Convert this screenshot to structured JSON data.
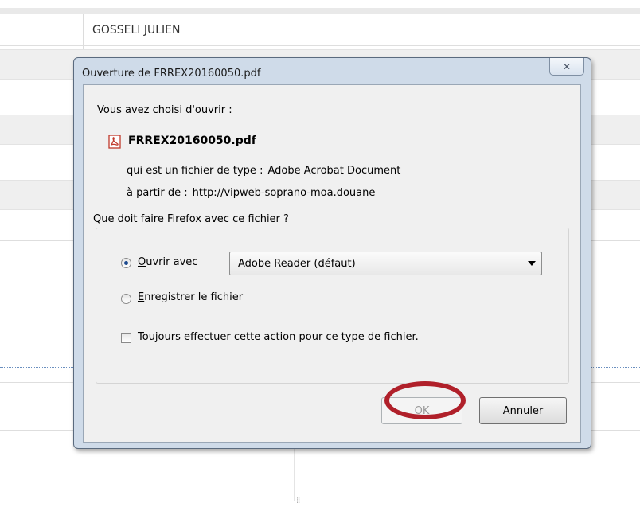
{
  "background": {
    "name_cell": "GOSSELI JULIEN"
  },
  "dialog": {
    "title": "Ouverture de FRREX20160050.pdf",
    "close_label": "✕",
    "intro": "Vous avez choisi d'ouvrir :",
    "file_icon": "pdf-icon",
    "filename": "FRREX20160050.pdf",
    "type_label": "qui est un fichier de type :",
    "type_value": "Adobe Acrobat Document",
    "from_label": "à partir de :",
    "from_value": "http://vipweb-soprano-moa.douane",
    "group_title": "Que doit faire Firefox avec ce fichier ?",
    "open_with_first": "O",
    "open_with_rest": "uvrir avec",
    "open_with_checked": true,
    "app_selected": "Adobe Reader  (défaut)",
    "save_first": "E",
    "save_rest": "nregistrer le fichier",
    "save_checked": false,
    "always_first": "T",
    "always_rest": "oujours effectuer cette action pour ce type de fichier.",
    "always_checked": false,
    "ok_label": "OK",
    "cancel_label": "Annuler"
  },
  "colors": {
    "dialog_frame": "#cfdbe9",
    "highlight_ring": "#b0202a",
    "radio_dot": "#1c4a8f"
  }
}
